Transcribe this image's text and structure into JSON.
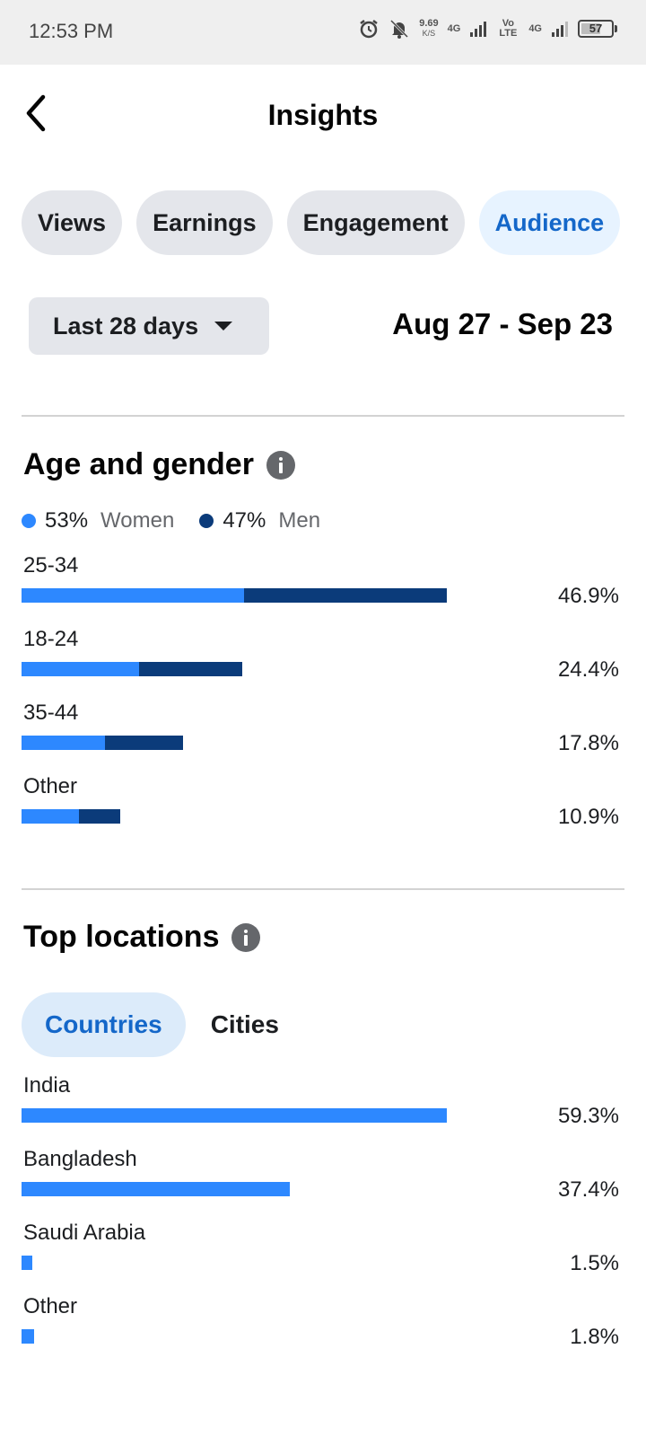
{
  "status_bar": {
    "time": "12:53 PM",
    "net_speed": "9.69",
    "net_unit": "K/S",
    "sim1": "4G",
    "sim2_label": "Vo LTE",
    "sim2": "4G",
    "battery": "57"
  },
  "header": {
    "title": "Insights"
  },
  "tabs": [
    {
      "label": "Views"
    },
    {
      "label": "Earnings"
    },
    {
      "label": "Engagement"
    },
    {
      "label": "Audience",
      "active": true
    }
  ],
  "range": {
    "label": "Last 28 days",
    "dates": "Aug 27 - Sep 23"
  },
  "age_gender": {
    "title": "Age and gender",
    "women_pct": "53%",
    "women_label": "Women",
    "men_pct": "47%",
    "men_label": "Men",
    "colors": {
      "women": "#2d88ff",
      "men": "#0b3b7a"
    },
    "rows": [
      {
        "label": "25-34",
        "value": "46.9%",
        "total": 46.9,
        "women": 24.5,
        "men": 22.4
      },
      {
        "label": "18-24",
        "value": "24.4%",
        "total": 24.4,
        "women": 13.0,
        "men": 11.4
      },
      {
        "label": "35-44",
        "value": "17.8%",
        "total": 17.8,
        "women": 9.2,
        "men": 8.6
      },
      {
        "label": "Other",
        "value": "10.9%",
        "total": 10.9,
        "women": 6.3,
        "men": 4.6
      }
    ]
  },
  "top_locations": {
    "title": "Top locations",
    "tabs": [
      "Countries",
      "Cities"
    ],
    "active_tab": "Countries",
    "rows": [
      {
        "label": "India",
        "value": "59.3%",
        "pct": 59.3
      },
      {
        "label": "Bangladesh",
        "value": "37.4%",
        "pct": 37.4
      },
      {
        "label": "Saudi Arabia",
        "value": "1.5%",
        "pct": 1.5
      },
      {
        "label": "Other",
        "value": "1.8%",
        "pct": 1.8
      }
    ]
  }
}
